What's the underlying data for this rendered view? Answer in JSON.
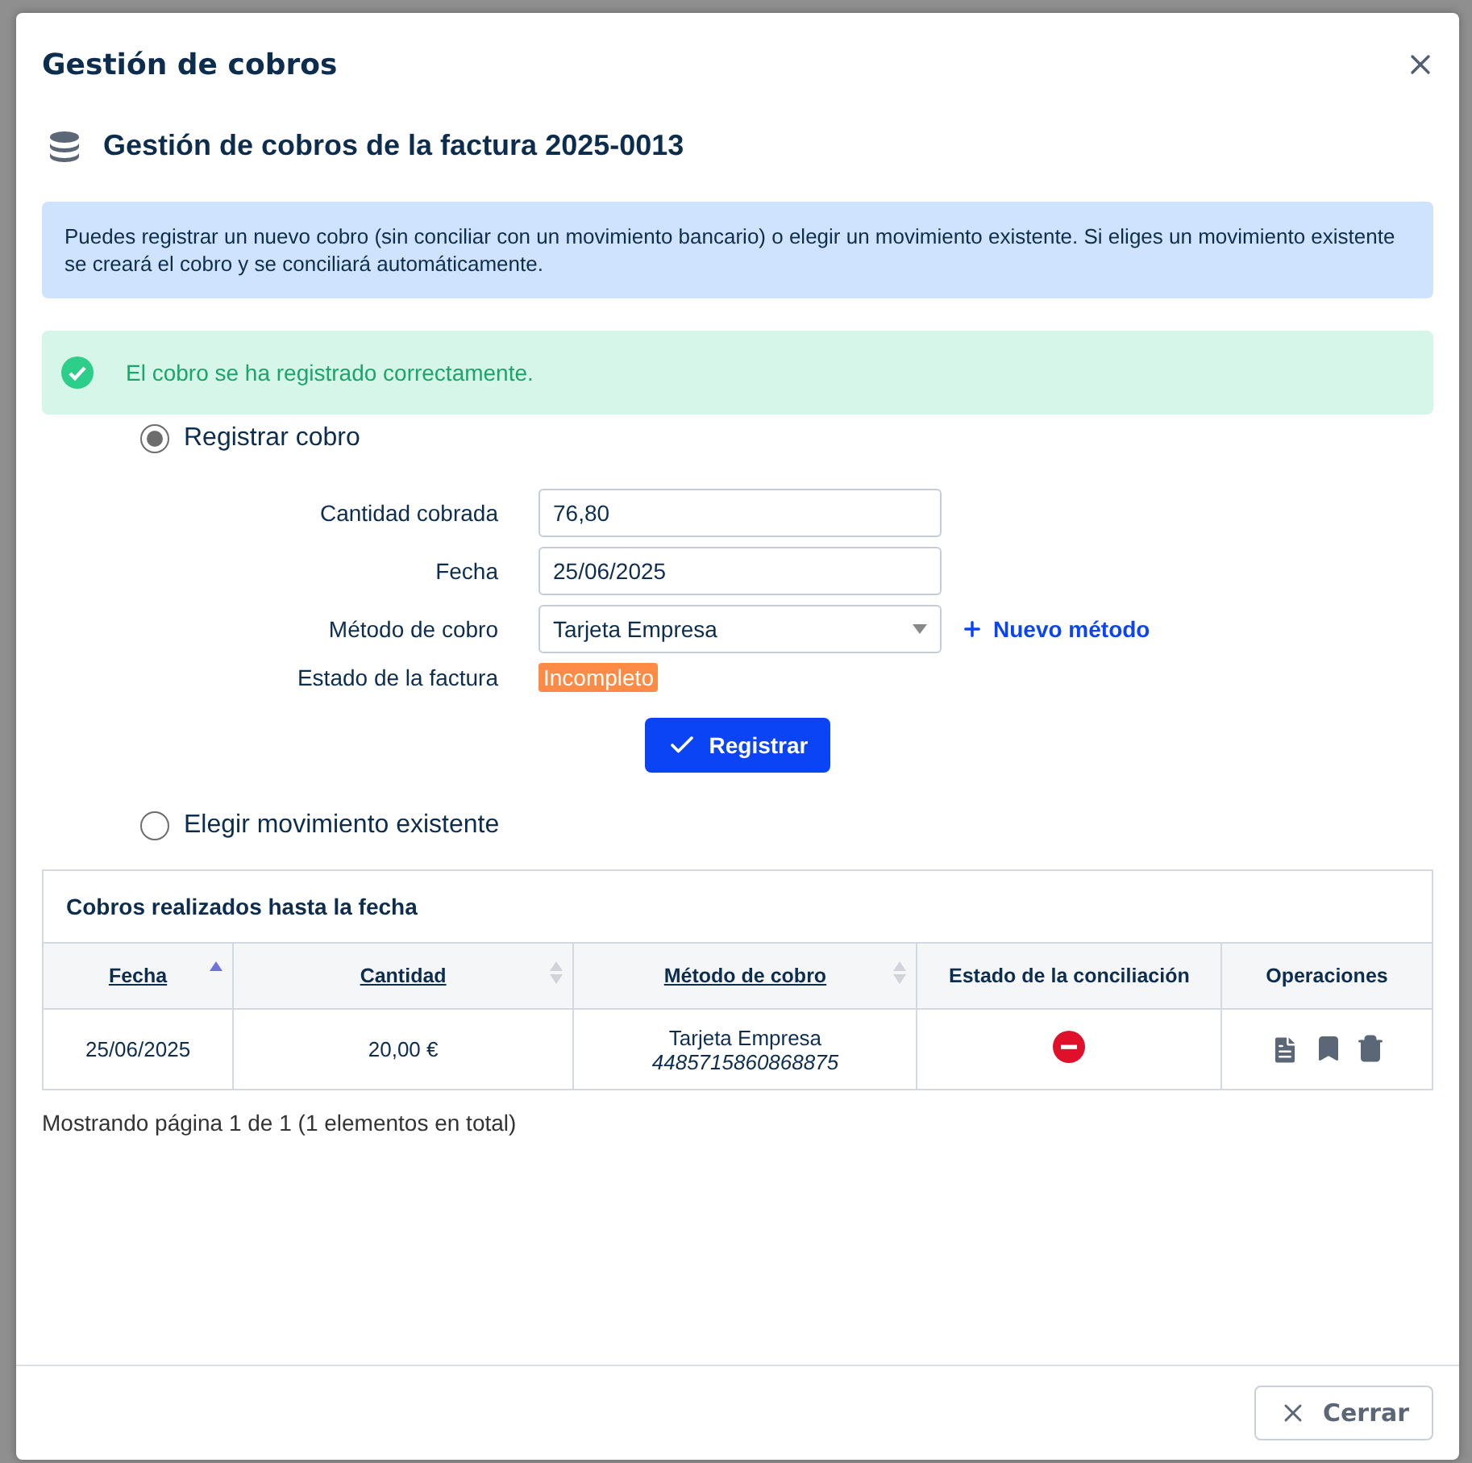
{
  "dialog": {
    "title": "Gestión de cobros",
    "heading": "Gestión de cobros de la factura 2025-0013"
  },
  "info": "Puedes registrar un nuevo cobro (sin conciliar con un movimiento bancario) o elegir un movimiento existente. Si eliges un movimiento existente se creará el cobro y se conciliará automáticamente.",
  "success": "El cobro se ha registrado correctamente.",
  "options": [
    {
      "label": "Registrar cobro",
      "selected": true
    },
    {
      "label": "Elegir movimiento existente",
      "selected": false
    }
  ],
  "form": {
    "fields": [
      {
        "label": "Cantidad cobrada",
        "kind": "text",
        "value": "76,80"
      },
      {
        "label": "Fecha",
        "kind": "text",
        "value": "25/06/2025"
      },
      {
        "label": "Método de cobro",
        "kind": "select",
        "value": "Tarjeta Empresa",
        "link": "Nuevo método"
      },
      {
        "label": "Estado de la factura",
        "kind": "badge",
        "value": "Incompleto"
      }
    ],
    "submit": "Registrar"
  },
  "table": {
    "title": "Cobros realizados hasta la fecha",
    "columns": [
      {
        "label": "Fecha",
        "sortable": true,
        "sorted": true
      },
      {
        "label": "Cantidad",
        "sortable": true,
        "sorted": false
      },
      {
        "label": "Método de cobro",
        "sortable": true,
        "sorted": false
      },
      {
        "label": "Estado de la conciliación",
        "sortable": false
      },
      {
        "label": "Operaciones",
        "sortable": false
      }
    ],
    "rows": [
      {
        "fecha": "25/06/2025",
        "cantidad": "20,00 €",
        "metodo": "Tarjeta Empresa",
        "cuenta": "4485715860868875",
        "conciliado": false
      }
    ]
  },
  "pagination": "Mostrando página 1 de 1 (1 elementos en total)",
  "footer": {
    "close": "Cerrar"
  }
}
